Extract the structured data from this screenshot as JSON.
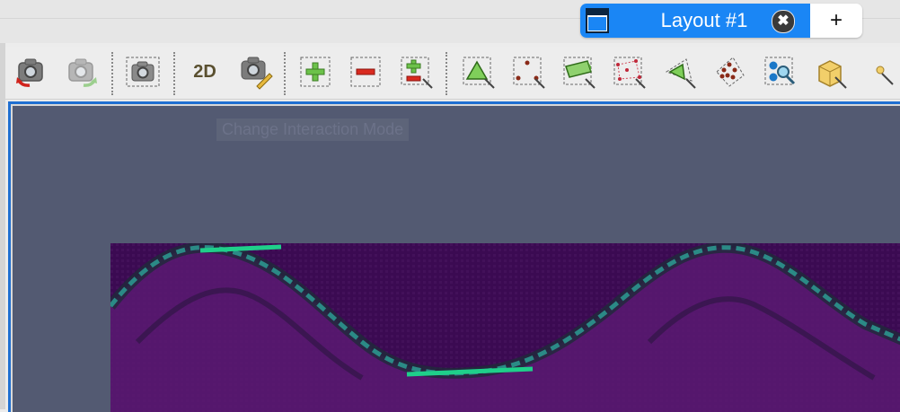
{
  "tab": {
    "title": "Layout #1",
    "close_symbol": "✖",
    "add_symbol": "+"
  },
  "toolbar": {
    "items": [
      {
        "name": "reset-camera-icon"
      },
      {
        "name": "reset-camera-closest-icon"
      },
      {
        "name": "capture-screenshot-icon"
      },
      {
        "name": "toggle-2d-3d-button",
        "label": "2D"
      },
      {
        "name": "adjust-camera-icon"
      },
      {
        "name": "zoom-in-icon"
      },
      {
        "name": "zoom-out-icon"
      },
      {
        "name": "zoom-to-box-icon"
      },
      {
        "name": "select-cells-on-icon"
      },
      {
        "name": "select-points-on-icon"
      },
      {
        "name": "select-cells-frustum-icon"
      },
      {
        "name": "select-points-frustum-icon"
      },
      {
        "name": "select-cells-polygon-icon"
      },
      {
        "name": "select-points-polygon-icon"
      },
      {
        "name": "interactive-select-icon"
      },
      {
        "name": "hover-cells-icon"
      },
      {
        "name": "hover-points-icon"
      }
    ]
  },
  "view": {
    "tooltip": "Change Interaction Mode"
  },
  "colors": {
    "tab_active": "#1a86f5",
    "view_background": "#535a72",
    "view_border": "#1f6fd1",
    "heatmap_base": "#3b0a52",
    "heatmap_highlight": "#1fcf8a"
  }
}
